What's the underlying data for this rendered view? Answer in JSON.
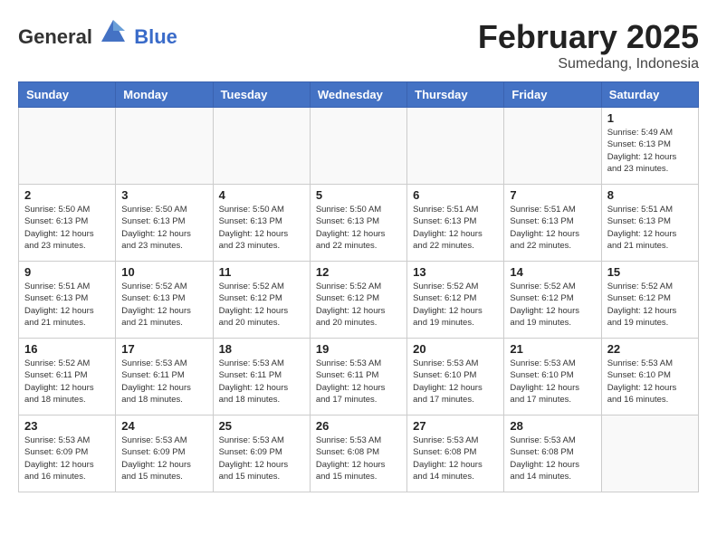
{
  "header": {
    "logo_general": "General",
    "logo_blue": "Blue",
    "month_title": "February 2025",
    "location": "Sumedang, Indonesia"
  },
  "weekdays": [
    "Sunday",
    "Monday",
    "Tuesday",
    "Wednesday",
    "Thursday",
    "Friday",
    "Saturday"
  ],
  "weeks": [
    [
      {
        "day": "",
        "info": ""
      },
      {
        "day": "",
        "info": ""
      },
      {
        "day": "",
        "info": ""
      },
      {
        "day": "",
        "info": ""
      },
      {
        "day": "",
        "info": ""
      },
      {
        "day": "",
        "info": ""
      },
      {
        "day": "1",
        "info": "Sunrise: 5:49 AM\nSunset: 6:13 PM\nDaylight: 12 hours\nand 23 minutes."
      }
    ],
    [
      {
        "day": "2",
        "info": "Sunrise: 5:50 AM\nSunset: 6:13 PM\nDaylight: 12 hours\nand 23 minutes."
      },
      {
        "day": "3",
        "info": "Sunrise: 5:50 AM\nSunset: 6:13 PM\nDaylight: 12 hours\nand 23 minutes."
      },
      {
        "day": "4",
        "info": "Sunrise: 5:50 AM\nSunset: 6:13 PM\nDaylight: 12 hours\nand 23 minutes."
      },
      {
        "day": "5",
        "info": "Sunrise: 5:50 AM\nSunset: 6:13 PM\nDaylight: 12 hours\nand 22 minutes."
      },
      {
        "day": "6",
        "info": "Sunrise: 5:51 AM\nSunset: 6:13 PM\nDaylight: 12 hours\nand 22 minutes."
      },
      {
        "day": "7",
        "info": "Sunrise: 5:51 AM\nSunset: 6:13 PM\nDaylight: 12 hours\nand 22 minutes."
      },
      {
        "day": "8",
        "info": "Sunrise: 5:51 AM\nSunset: 6:13 PM\nDaylight: 12 hours\nand 21 minutes."
      }
    ],
    [
      {
        "day": "9",
        "info": "Sunrise: 5:51 AM\nSunset: 6:13 PM\nDaylight: 12 hours\nand 21 minutes."
      },
      {
        "day": "10",
        "info": "Sunrise: 5:52 AM\nSunset: 6:13 PM\nDaylight: 12 hours\nand 21 minutes."
      },
      {
        "day": "11",
        "info": "Sunrise: 5:52 AM\nSunset: 6:12 PM\nDaylight: 12 hours\nand 20 minutes."
      },
      {
        "day": "12",
        "info": "Sunrise: 5:52 AM\nSunset: 6:12 PM\nDaylight: 12 hours\nand 20 minutes."
      },
      {
        "day": "13",
        "info": "Sunrise: 5:52 AM\nSunset: 6:12 PM\nDaylight: 12 hours\nand 19 minutes."
      },
      {
        "day": "14",
        "info": "Sunrise: 5:52 AM\nSunset: 6:12 PM\nDaylight: 12 hours\nand 19 minutes."
      },
      {
        "day": "15",
        "info": "Sunrise: 5:52 AM\nSunset: 6:12 PM\nDaylight: 12 hours\nand 19 minutes."
      }
    ],
    [
      {
        "day": "16",
        "info": "Sunrise: 5:52 AM\nSunset: 6:11 PM\nDaylight: 12 hours\nand 18 minutes."
      },
      {
        "day": "17",
        "info": "Sunrise: 5:53 AM\nSunset: 6:11 PM\nDaylight: 12 hours\nand 18 minutes."
      },
      {
        "day": "18",
        "info": "Sunrise: 5:53 AM\nSunset: 6:11 PM\nDaylight: 12 hours\nand 18 minutes."
      },
      {
        "day": "19",
        "info": "Sunrise: 5:53 AM\nSunset: 6:11 PM\nDaylight: 12 hours\nand 17 minutes."
      },
      {
        "day": "20",
        "info": "Sunrise: 5:53 AM\nSunset: 6:10 PM\nDaylight: 12 hours\nand 17 minutes."
      },
      {
        "day": "21",
        "info": "Sunrise: 5:53 AM\nSunset: 6:10 PM\nDaylight: 12 hours\nand 17 minutes."
      },
      {
        "day": "22",
        "info": "Sunrise: 5:53 AM\nSunset: 6:10 PM\nDaylight: 12 hours\nand 16 minutes."
      }
    ],
    [
      {
        "day": "23",
        "info": "Sunrise: 5:53 AM\nSunset: 6:09 PM\nDaylight: 12 hours\nand 16 minutes."
      },
      {
        "day": "24",
        "info": "Sunrise: 5:53 AM\nSunset: 6:09 PM\nDaylight: 12 hours\nand 15 minutes."
      },
      {
        "day": "25",
        "info": "Sunrise: 5:53 AM\nSunset: 6:09 PM\nDaylight: 12 hours\nand 15 minutes."
      },
      {
        "day": "26",
        "info": "Sunrise: 5:53 AM\nSunset: 6:08 PM\nDaylight: 12 hours\nand 15 minutes."
      },
      {
        "day": "27",
        "info": "Sunrise: 5:53 AM\nSunset: 6:08 PM\nDaylight: 12 hours\nand 14 minutes."
      },
      {
        "day": "28",
        "info": "Sunrise: 5:53 AM\nSunset: 6:08 PM\nDaylight: 12 hours\nand 14 minutes."
      },
      {
        "day": "",
        "info": ""
      }
    ]
  ]
}
